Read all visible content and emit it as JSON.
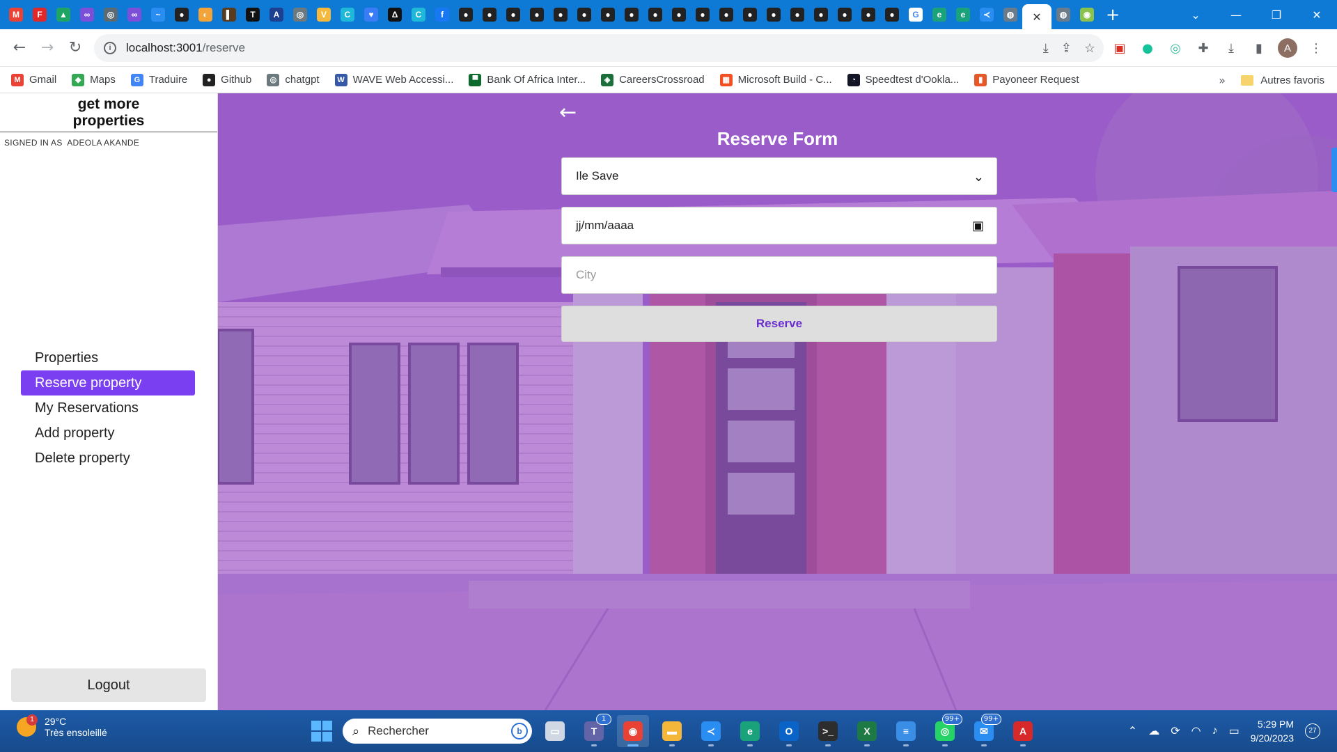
{
  "browser": {
    "tab_favicons": [
      {
        "name": "gmail-favicon",
        "label": "M",
        "color": "#ea4335"
      },
      {
        "name": "flipboard-favicon",
        "label": "F",
        "color": "#e12828"
      },
      {
        "name": "drive-favicon",
        "label": "▲",
        "color": "#1fa463"
      },
      {
        "name": "meta-favicon",
        "label": "∞",
        "color": "#7b4fd8"
      },
      {
        "name": "chatgpt-favicon",
        "label": "◎",
        "color": "#5a6b74"
      },
      {
        "name": "meta-favicon-2",
        "label": "∞",
        "color": "#7b4fd8"
      },
      {
        "name": "messenger-favicon",
        "label": "~",
        "color": "#2a8df2"
      },
      {
        "name": "github-favicon",
        "label": "●",
        "color": "#222222"
      },
      {
        "name": "duck-favicon",
        "label": "◐",
        "color": "#f2a33a"
      },
      {
        "name": "book-favicon",
        "label": "▌",
        "color": "#5b3b1e"
      },
      {
        "name": "typora-favicon",
        "label": "T",
        "color": "#111111"
      },
      {
        "name": "a-favicon",
        "label": "A",
        "color": "#1c3f8f"
      },
      {
        "name": "openai-favicon",
        "label": "◎",
        "color": "#6c7a80"
      },
      {
        "name": "vue-favicon",
        "label": "V",
        "color": "#f6b93b"
      },
      {
        "name": "canva-favicon",
        "label": "C",
        "color": "#1fb8d8"
      },
      {
        "name": "heart-favicon",
        "label": "♥",
        "color": "#3a7cf5"
      },
      {
        "name": "delta-favicon",
        "label": "Δ",
        "color": "#111111"
      },
      {
        "name": "canva-favicon-2",
        "label": "C",
        "color": "#1fb8d8"
      },
      {
        "name": "facebook-favicon",
        "label": "f",
        "color": "#1877f2"
      },
      {
        "name": "github-favicon-2",
        "label": "●",
        "color": "#222222"
      },
      {
        "name": "github-favicon-3",
        "label": "●",
        "color": "#222222"
      },
      {
        "name": "github-favicon-4",
        "label": "●",
        "color": "#222222"
      },
      {
        "name": "github-favicon-5",
        "label": "●",
        "color": "#222222"
      },
      {
        "name": "github-favicon-6",
        "label": "●",
        "color": "#222222"
      },
      {
        "name": "github-favicon-7",
        "label": "●",
        "color": "#222222"
      },
      {
        "name": "github-favicon-8",
        "label": "●",
        "color": "#222222"
      },
      {
        "name": "github-favicon-9",
        "label": "●",
        "color": "#222222"
      },
      {
        "name": "github-favicon-10",
        "label": "●",
        "color": "#222222"
      },
      {
        "name": "github-favicon-11",
        "label": "●",
        "color": "#222222"
      },
      {
        "name": "github-favicon-12",
        "label": "●",
        "color": "#222222"
      },
      {
        "name": "github-favicon-13",
        "label": "●",
        "color": "#222222"
      },
      {
        "name": "github-favicon-14",
        "label": "●",
        "color": "#222222"
      },
      {
        "name": "github-favicon-15",
        "label": "●",
        "color": "#222222"
      },
      {
        "name": "github-favicon-16",
        "label": "●",
        "color": "#222222"
      },
      {
        "name": "github-favicon-17",
        "label": "●",
        "color": "#222222"
      },
      {
        "name": "github-favicon-18",
        "label": "●",
        "color": "#222222"
      },
      {
        "name": "github-favicon-19",
        "label": "●",
        "color": "#222222"
      },
      {
        "name": "github-favicon-20",
        "label": "●",
        "color": "#222222"
      },
      {
        "name": "google-favicon",
        "label": "G",
        "color": "#ffffff"
      },
      {
        "name": "edge-favicon",
        "label": "e",
        "color": "#1aa27a"
      },
      {
        "name": "edge-favicon-2",
        "label": "e",
        "color": "#1aa27a"
      },
      {
        "name": "vscode-favicon",
        "label": "≺",
        "color": "#2a8df2"
      },
      {
        "name": "globe-favicon",
        "label": "◍",
        "color": "#6b7b8a"
      }
    ],
    "active_tab_close": "✕",
    "extra_tab_favicons": [
      {
        "name": "globe-favicon-2",
        "label": "◍",
        "color": "#6b7b8a"
      },
      {
        "name": "lime-favicon",
        "label": "◉",
        "color": "#8bc34a"
      }
    ],
    "new_tab": "+",
    "window_controls": {
      "dropdown": "⌄",
      "minimize": "—",
      "restore": "❐",
      "close": "✕"
    },
    "url_host": "localhost:3001",
    "url_path": "/reserve",
    "avatar_letter": "A",
    "bookmarks": [
      {
        "name": "bookmark-gmail",
        "label": "Gmail",
        "icon": "M",
        "color": "#ea4335"
      },
      {
        "name": "bookmark-maps",
        "label": "Maps",
        "icon": "◆",
        "color": "#34a853"
      },
      {
        "name": "bookmark-traduire",
        "label": "Traduire",
        "icon": "G",
        "color": "#4285f4"
      },
      {
        "name": "bookmark-github",
        "label": "Github",
        "icon": "●",
        "color": "#222222"
      },
      {
        "name": "bookmark-chatgpt",
        "label": "chatgpt",
        "icon": "◎",
        "color": "#6c7a80"
      },
      {
        "name": "bookmark-wave",
        "label": "WAVE Web Accessi...",
        "icon": "W",
        "color": "#3559a8"
      },
      {
        "name": "bookmark-bank-of-africa",
        "label": "Bank Of Africa Inter...",
        "icon": "▀",
        "color": "#0b6b2d"
      },
      {
        "name": "bookmark-careerscrossroad",
        "label": "CareersCrossroad",
        "icon": "◈",
        "color": "#1b6f3a"
      },
      {
        "name": "bookmark-microsoft-build",
        "label": "Microsoft Build - C...",
        "icon": "▦",
        "color": "#f25022"
      },
      {
        "name": "bookmark-speedtest",
        "label": "Speedtest d'Ookla...",
        "icon": "◔",
        "color": "#141526"
      },
      {
        "name": "bookmark-payoneer",
        "label": "Payoneer Request",
        "icon": "▮",
        "color": "#e6582a"
      }
    ],
    "bookmarks_more": "»",
    "other_bookmarks": "Autres favoris"
  },
  "sidebar": {
    "brand": "get more properties",
    "signed_in_prefix": "SIGNED IN AS",
    "signed_in_user": "ADEOLA AKANDE",
    "nav": [
      {
        "label": "Properties",
        "active": false
      },
      {
        "label": "Reserve property",
        "active": true
      },
      {
        "label": "My Reservations",
        "active": false
      },
      {
        "label": "Add property",
        "active": false
      },
      {
        "label": "Delete property",
        "active": false
      }
    ],
    "logout": "Logout"
  },
  "form": {
    "back_icon": "←",
    "title": "Reserve Form",
    "property_select": "Ile Save",
    "date_placeholder": "jj/mm/aaaa",
    "city_placeholder": "City",
    "submit": "Reserve"
  },
  "taskbar": {
    "weather_temp": "29°C",
    "weather_desc": "Très ensoleillé",
    "weather_alert_count": "1",
    "search_placeholder": "Rechercher",
    "apps": [
      {
        "name": "taskview-icon",
        "label": "▭",
        "color": "#cfd8e3",
        "count": "",
        "active": false
      },
      {
        "name": "teams-icon",
        "label": "T",
        "color": "#6264a7",
        "count": "1",
        "active": false
      },
      {
        "name": "chrome-icon",
        "label": "◉",
        "color": "#e94235",
        "count": "",
        "active": true
      },
      {
        "name": "file-explorer-icon",
        "label": "▬",
        "color": "#f4b73a",
        "count": "",
        "active": false
      },
      {
        "name": "vscode-icon",
        "label": "≺",
        "color": "#2a8df2",
        "count": "",
        "active": false
      },
      {
        "name": "edge-icon",
        "label": "e",
        "color": "#1aa27a",
        "count": "",
        "active": false
      },
      {
        "name": "outlook-icon",
        "label": "O",
        "color": "#0a64c8",
        "count": "",
        "active": false
      },
      {
        "name": "terminal-icon",
        "label": ">_",
        "color": "#2d2d2d",
        "count": "",
        "active": false
      },
      {
        "name": "excel-icon",
        "label": "X",
        "color": "#1d7a45",
        "count": "",
        "active": false
      },
      {
        "name": "notepad-icon",
        "label": "≡",
        "color": "#3a8ee6",
        "count": "",
        "active": false
      },
      {
        "name": "whatsapp-icon",
        "label": "◎",
        "color": "#25d366",
        "count": "99+",
        "active": false
      },
      {
        "name": "mail-icon",
        "label": "✉",
        "color": "#2a8df2",
        "count": "99+",
        "active": false
      },
      {
        "name": "acrobat-icon",
        "label": "A",
        "color": "#d7282a",
        "count": "",
        "active": false
      }
    ],
    "time": "5:29 PM",
    "date": "9/20/2023",
    "notification_count": "27"
  }
}
